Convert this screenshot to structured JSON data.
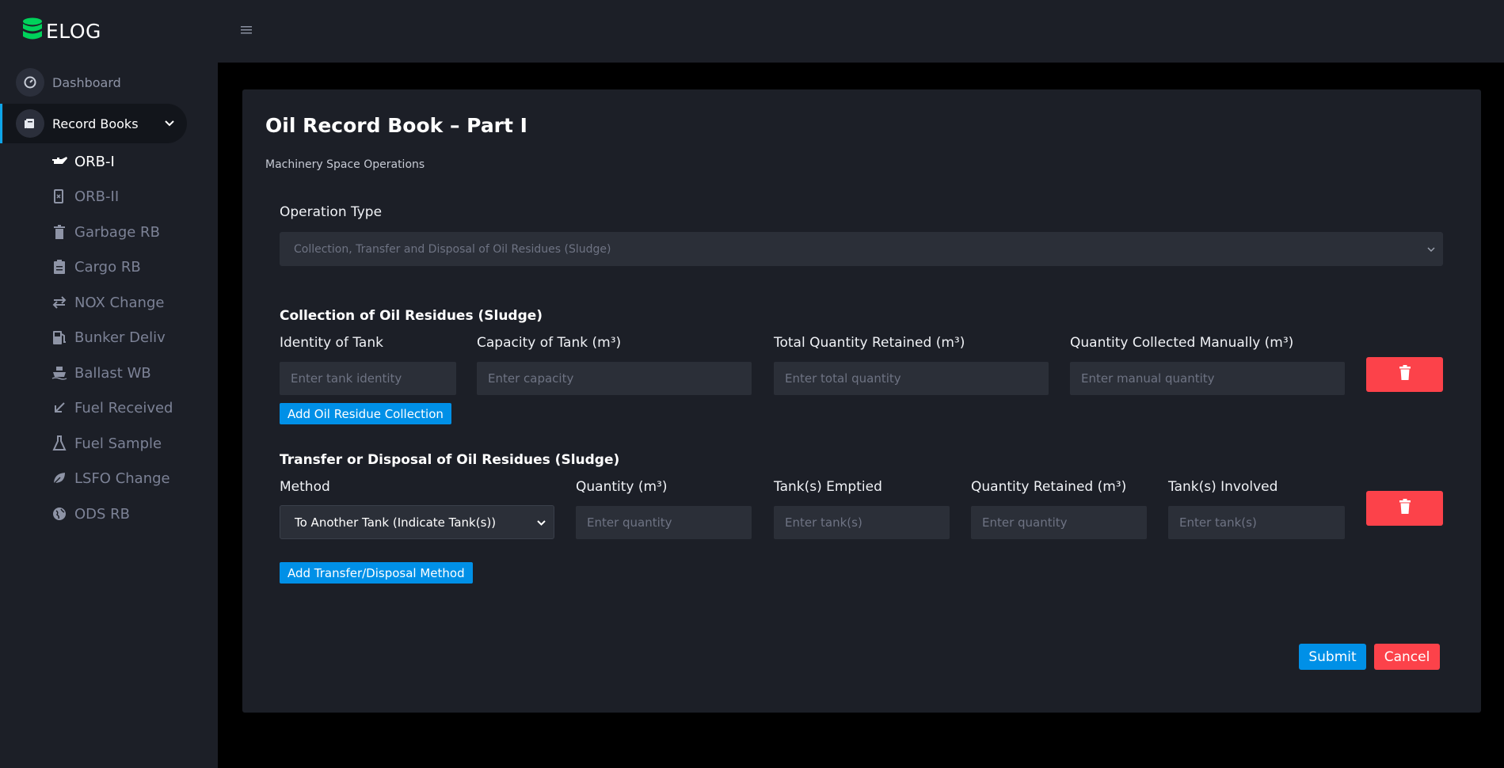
{
  "brand": {
    "name": "ELOG"
  },
  "sidebar": {
    "dashboard_label": "Dashboard",
    "record_books_label": "Record Books",
    "sub_items": [
      {
        "label": "ORB-I",
        "icon": "oil-can-icon",
        "active": true
      },
      {
        "label": "ORB-II",
        "icon": "gas-pump-icon"
      },
      {
        "label": "Garbage RB",
        "icon": "trash-icon"
      },
      {
        "label": "Cargo RB",
        "icon": "clipboard-icon"
      },
      {
        "label": "NOX Change",
        "icon": "exchange-arrows-icon"
      },
      {
        "label": "Bunker Deliv",
        "icon": "fuel-pump-icon"
      },
      {
        "label": "Ballast WB",
        "icon": "ship-icon"
      },
      {
        "label": "Fuel Received",
        "icon": "arrow-down-left-icon"
      },
      {
        "label": "Fuel Sample",
        "icon": "flask-icon"
      },
      {
        "label": "LSFO Change",
        "icon": "leaf-icon"
      },
      {
        "label": "ODS RB",
        "icon": "globe-icon"
      }
    ]
  },
  "page": {
    "title": "Oil Record Book – Part I",
    "subtitle": "Machinery Space Operations"
  },
  "operation": {
    "label": "Operation Type",
    "selected": "Collection, Transfer and Disposal of Oil Residues (Sludge)"
  },
  "collection": {
    "title": "Collection of Oil Residues (Sludge)",
    "fields": [
      {
        "label": "Identity of Tank",
        "placeholder": "Enter tank identity"
      },
      {
        "label": "Capacity of Tank (m³)",
        "placeholder": "Enter capacity"
      },
      {
        "label": "Total Quantity Retained (m³)",
        "placeholder": "Enter total quantity"
      },
      {
        "label": "Quantity Collected Manually (m³)",
        "placeholder": "Enter manual quantity"
      }
    ],
    "add_label": "Add Oil Residue Collection"
  },
  "transfer": {
    "title": "Transfer or Disposal of Oil Residues (Sludge)",
    "method_label": "Method",
    "method_selected": "To Another Tank (Indicate Tank(s))",
    "fields": [
      {
        "label": "Quantity (m³)",
        "placeholder": "Enter quantity"
      },
      {
        "label": "Tank(s) Emptied",
        "placeholder": "Enter tank(s)"
      },
      {
        "label": "Quantity Retained (m³)",
        "placeholder": "Enter quantity"
      },
      {
        "label": "Tank(s) Involved",
        "placeholder": "Enter tank(s)"
      }
    ],
    "add_label": "Add Transfer/Disposal Method"
  },
  "actions": {
    "submit": "Submit",
    "cancel": "Cancel"
  },
  "colors": {
    "accent": "#0090e7",
    "danger": "#fc424a",
    "brand_green": "#00d25b"
  }
}
